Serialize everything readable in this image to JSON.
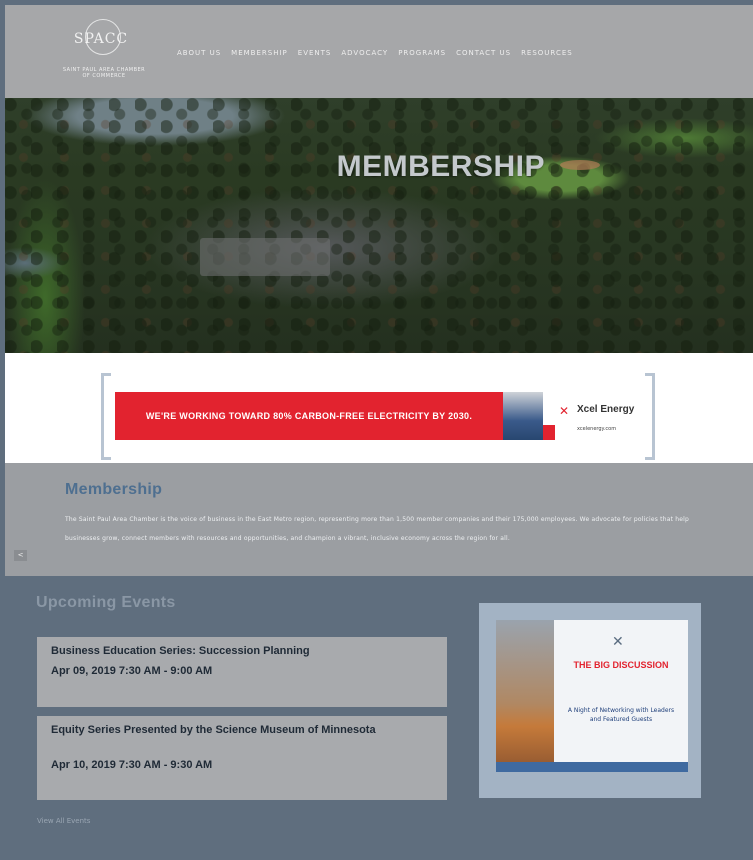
{
  "header": {
    "logo_text": "SAINT PAUL AREA CHAMBER",
    "logo_tagline": "SAINT PAUL AREA CHAMBER OF COMMERCE",
    "nav": [
      "ABOUT US",
      "MEMBERSHIP",
      "EVENTS",
      "ADVOCACY",
      "PROGRAMS",
      "CONTACT US",
      "RESOURCES"
    ]
  },
  "hero": {
    "title": "MEMBERSHIP"
  },
  "banner": {
    "text": "WE'RE WORKING TOWARD 80% CARBON-FREE ELECTRICITY BY 2030.",
    "brand": "Xcel Energy",
    "url": "xcelenergy.com"
  },
  "membership": {
    "heading": "Membership",
    "body": "The Saint Paul Area Chamber is the voice of business in the East Metro region, representing more than 1,500 member companies and their 175,000 employees. We advocate for policies that help businesses grow, connect members with resources and opportunities, and champion a vibrant, inclusive economy across the region for all."
  },
  "events": {
    "heading": "Upcoming Events",
    "items": [
      {
        "title": "Business Education Series: Succession Planning",
        "date": "Apr 09, 2019 7:30 AM - 9:00 AM"
      },
      {
        "title": "Equity Series Presented by the Science Museum of Minnesota",
        "date": "Apr 10, 2019 7:30 AM - 9:30 AM"
      }
    ],
    "view_all": "View All Events"
  },
  "promo": {
    "title": "THE BIG DISCUSSION",
    "subtitle": "A Night of Networking with Leaders and Featured Guests"
  },
  "scroll_button": "<"
}
